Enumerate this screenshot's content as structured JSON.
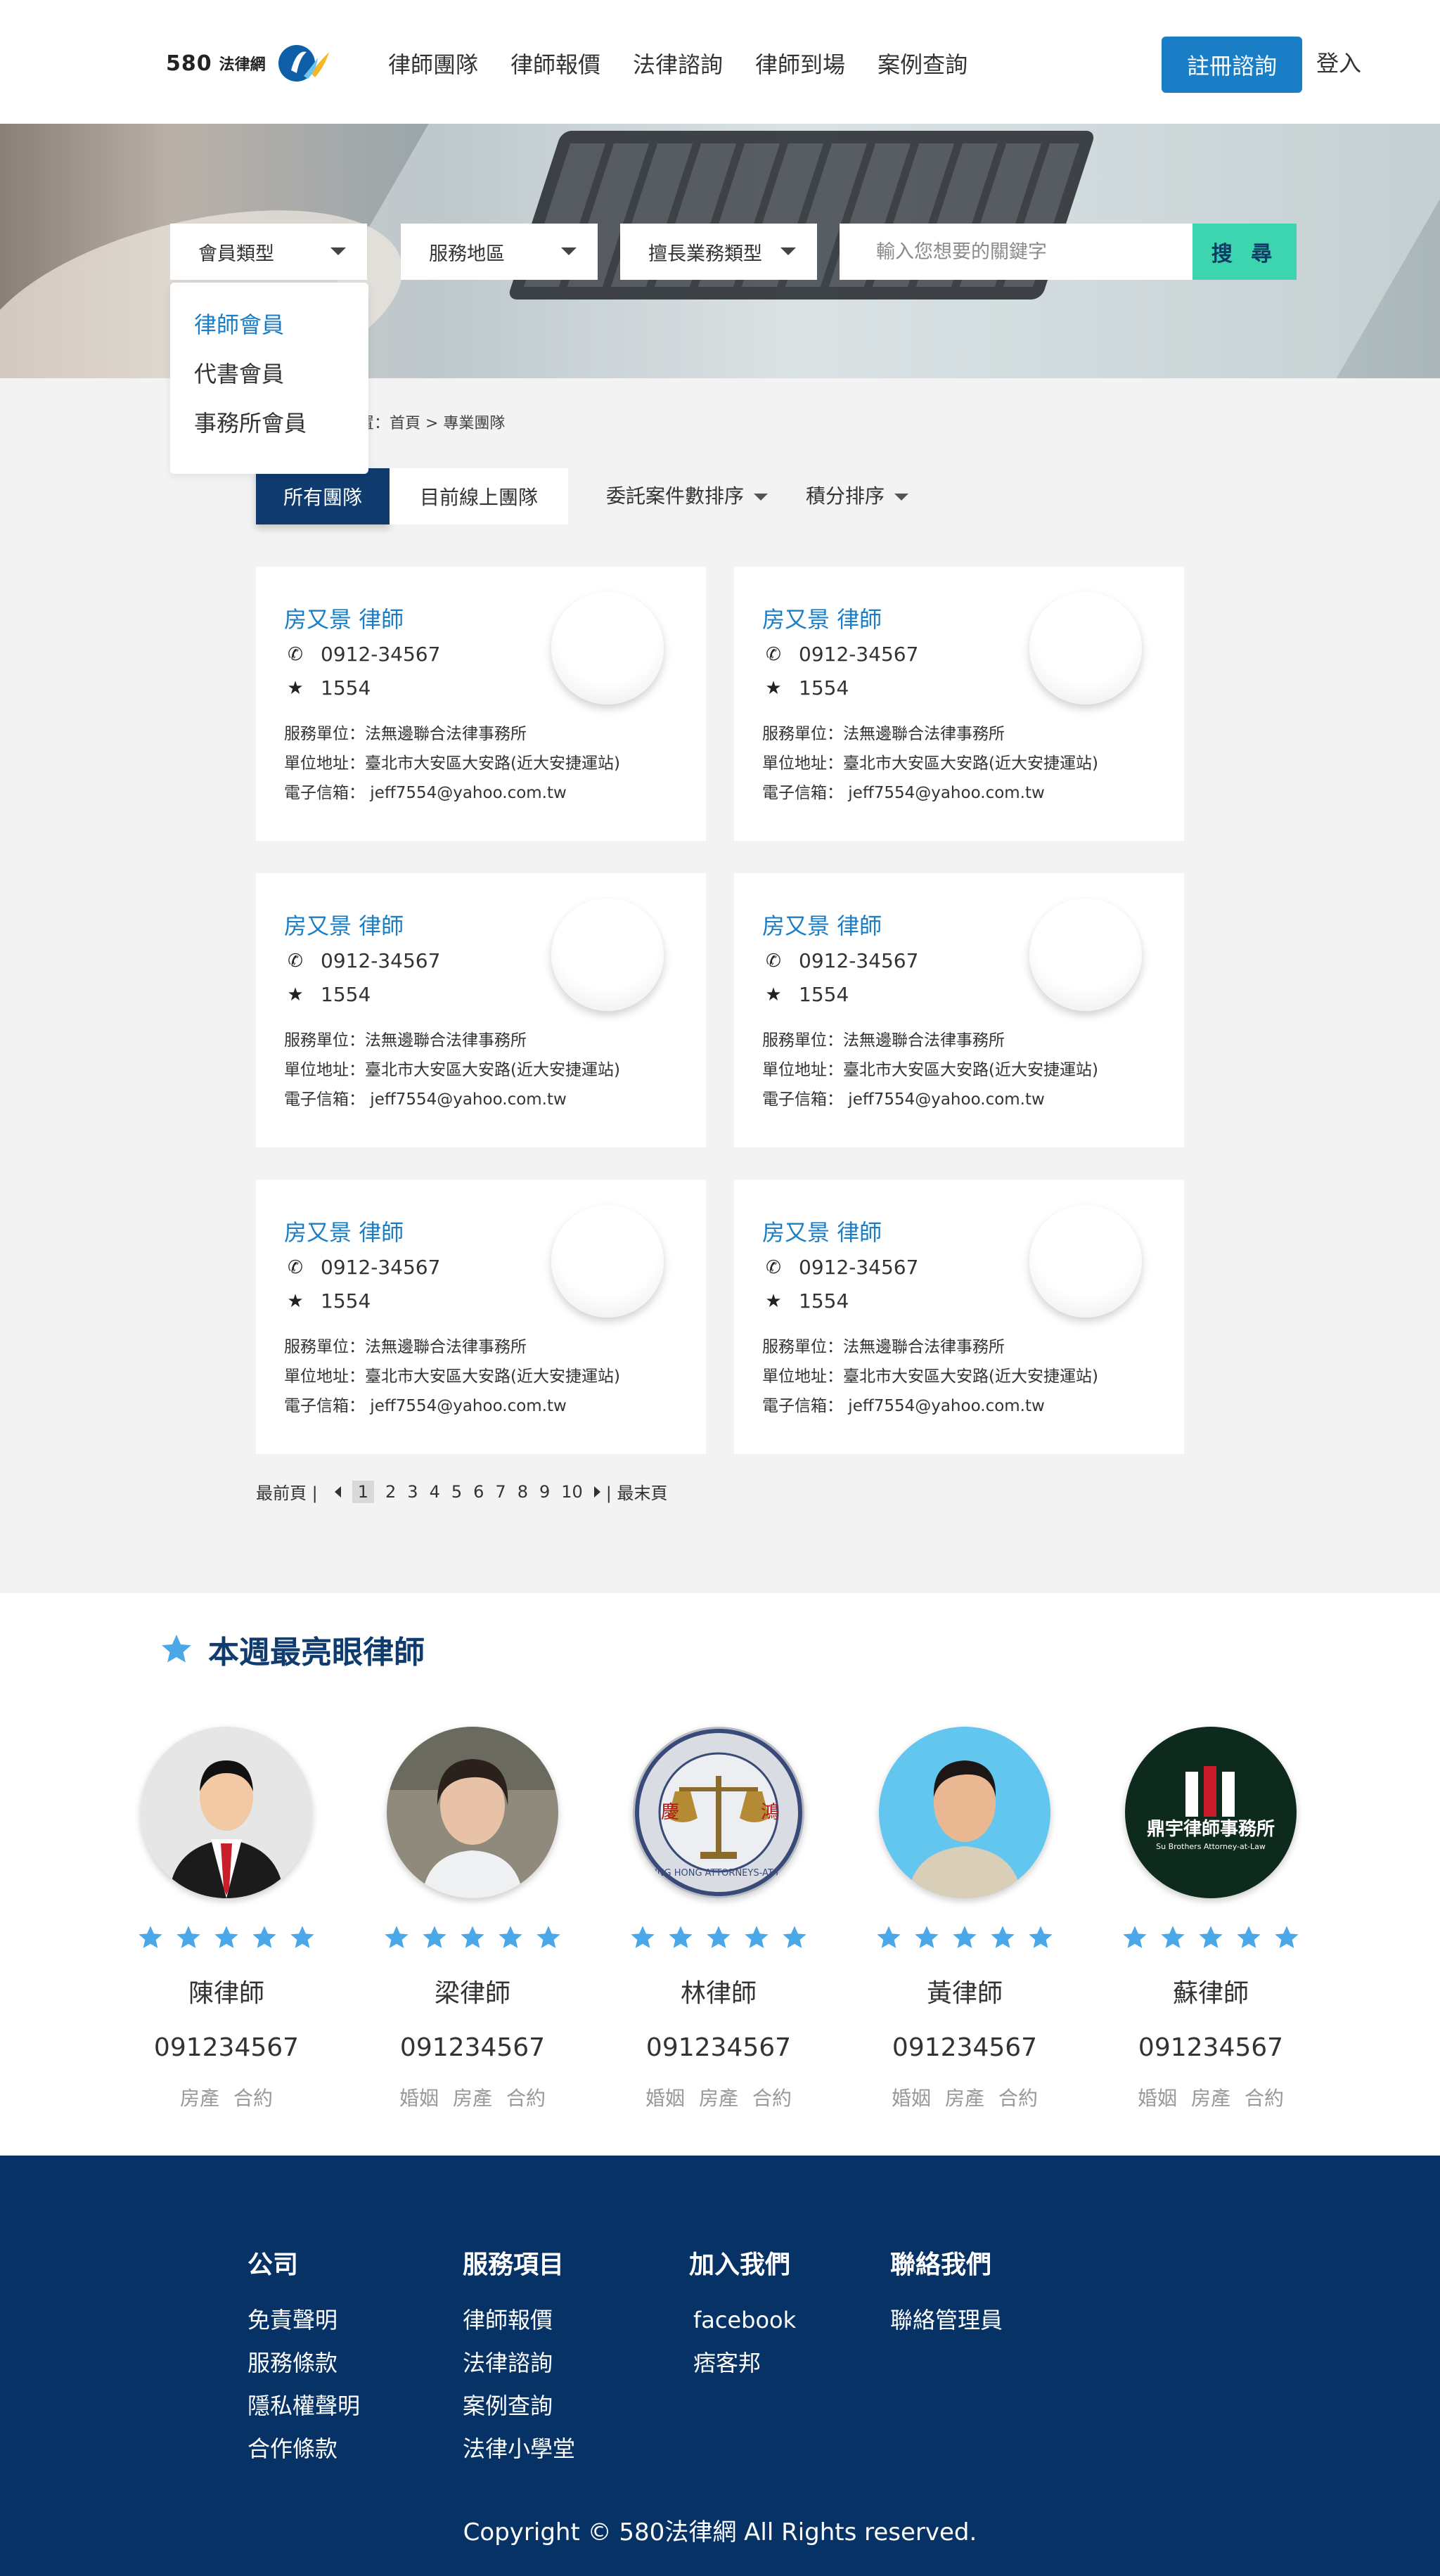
{
  "header": {
    "logo_number": "580",
    "logo_text": "法律網",
    "nav": [
      "律師團隊",
      "律師報價",
      "法律諮詢",
      "律師到場",
      "案例查詢"
    ],
    "register_label": "註冊諮詢",
    "login_label": "登入"
  },
  "search": {
    "member_type": "會員類型",
    "service_area": "服務地區",
    "practice_area": "擅長業務類型",
    "keyword_placeholder": "輸入您想要的關鍵字",
    "search_label": "搜 尋",
    "dropdown_items": [
      "律師會員",
      "代書會員",
      "事務所會員"
    ]
  },
  "breadcrumb": "您的位置：首頁 > 專業團隊",
  "tabs": [
    "所有團隊",
    "目前線上團隊"
  ],
  "sort": [
    "委託案件數排序",
    "積分排序"
  ],
  "cards": [
    {
      "name": "房又景 律師",
      "phone": "0912-34567",
      "score": "1554",
      "unit": "服務單位：法無邊聯合法律事務所",
      "address": "單位地址：臺北市大安區大安路(近大安捷運站)",
      "email": "電子信箱： jeff7554@yahoo.com.tw"
    },
    {
      "name": "房又景 律師",
      "phone": "0912-34567",
      "score": "1554",
      "unit": "服務單位：法無邊聯合法律事務所",
      "address": "單位地址：臺北市大安區大安路(近大安捷運站)",
      "email": "電子信箱： jeff7554@yahoo.com.tw"
    },
    {
      "name": "房又景 律師",
      "phone": "0912-34567",
      "score": "1554",
      "unit": "服務單位：法無邊聯合法律事務所",
      "address": "單位地址：臺北市大安區大安路(近大安捷運站)",
      "email": "電子信箱： jeff7554@yahoo.com.tw"
    },
    {
      "name": "房又景 律師",
      "phone": "0912-34567",
      "score": "1554",
      "unit": "服務單位：法無邊聯合法律事務所",
      "address": "單位地址：臺北市大安區大安路(近大安捷運站)",
      "email": "電子信箱： jeff7554@yahoo.com.tw"
    },
    {
      "name": "房又景 律師",
      "phone": "0912-34567",
      "score": "1554",
      "unit": "服務單位：法無邊聯合法律事務所",
      "address": "單位地址：臺北市大安區大安路(近大安捷運站)",
      "email": "電子信箱： jeff7554@yahoo.com.tw"
    },
    {
      "name": "房又景 律師",
      "phone": "0912-34567",
      "score": "1554",
      "unit": "服務單位：法無邊聯合法律事務所",
      "address": "單位地址：臺北市大安區大安路(近大安捷運站)",
      "email": "電子信箱： jeff7554@yahoo.com.tw"
    }
  ],
  "pagination": {
    "first": "最前頁 |",
    "pages": [
      "1",
      "2",
      "3",
      "4",
      "5",
      "6",
      "7",
      "8",
      "9",
      "10"
    ],
    "current": "1",
    "last": "| 最末頁"
  },
  "featured": {
    "title": "本週最亮眼律師",
    "rating": 5,
    "star_color": "#4aa8e8",
    "lawyers": [
      {
        "name": "陳律師",
        "phone": "091234567",
        "tags": [
          "房產",
          "合約"
        ],
        "photo": "suit-avatar"
      },
      {
        "name": "梁律師",
        "phone": "091234567",
        "tags": [
          "婚姻",
          "房產",
          "合約"
        ],
        "photo": "woman-portrait"
      },
      {
        "name": "林律師",
        "phone": "091234567",
        "tags": [
          "婚姻",
          "房產",
          "合約"
        ],
        "photo": "scales-seal",
        "seal_text": "CHING HONG ATTORNEYS-AT-LAW"
      },
      {
        "name": "黃律師",
        "phone": "091234567",
        "tags": [
          "婚姻",
          "房產",
          "合約"
        ],
        "photo": "man-portrait"
      },
      {
        "name": "蘇律師",
        "phone": "091234567",
        "tags": [
          "婚姻",
          "房產",
          "合約"
        ],
        "photo": "firm-logo",
        "logo_text": "鼎宇律師事務所",
        "logo_subtext": "Su Brothers Attorney-at-Law"
      }
    ]
  },
  "footer": {
    "columns": [
      {
        "title": "公司",
        "links": [
          "免責聲明",
          "服務條款",
          "隱私權聲明",
          "合作條款"
        ]
      },
      {
        "title": "服務項目",
        "links": [
          "律師報價",
          "法律諮詢",
          "案例查詢",
          "法律小學堂"
        ]
      },
      {
        "title": "加入我們",
        "links": [
          "facebook",
          "痞客邦"
        ]
      },
      {
        "title": "聯絡我們",
        "links": [
          "聯絡管理員"
        ]
      }
    ],
    "copyright": "Copyright ©  580法律網  All Rights reserved."
  },
  "colors": {
    "brand_blue": "#1a7ec7",
    "navy": "#063266",
    "search_button": "#3dd4b0"
  }
}
